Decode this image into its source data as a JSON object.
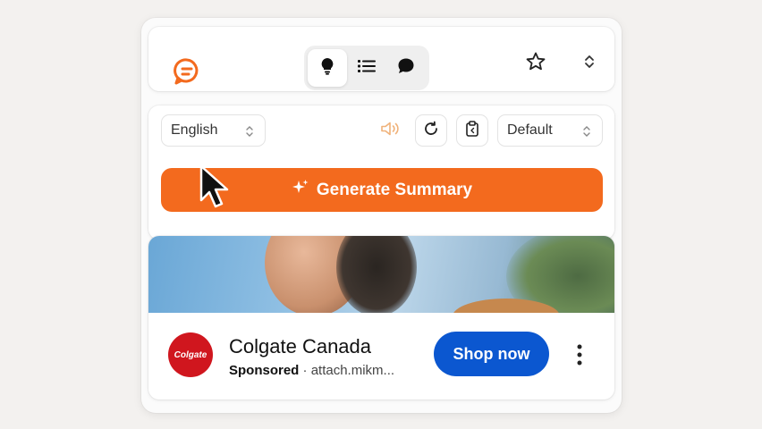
{
  "toolbar": {
    "modes": [
      {
        "icon": "lightbulb-icon",
        "active": true
      },
      {
        "icon": "list-icon",
        "active": false
      },
      {
        "icon": "chat-bubble-icon",
        "active": false
      }
    ],
    "favorite_icon": "star-icon",
    "expand_icon": "chevron-updown-icon"
  },
  "controls": {
    "language": "English",
    "style": "Default",
    "speak_icon": "speaker-icon",
    "regenerate_icon": "refresh-icon",
    "copy_icon": "clipboard-icon",
    "generate_label": "Generate Summary"
  },
  "ad": {
    "brand_logo_text": "Colgate",
    "title": "Colgate Canada",
    "sponsored": "Sponsored",
    "separator": "·",
    "domain": "attach.mikm...",
    "cta": "Shop now"
  },
  "colors": {
    "accent": "#f36a1e",
    "cta": "#0b57d0",
    "brand": "#d0161e"
  }
}
